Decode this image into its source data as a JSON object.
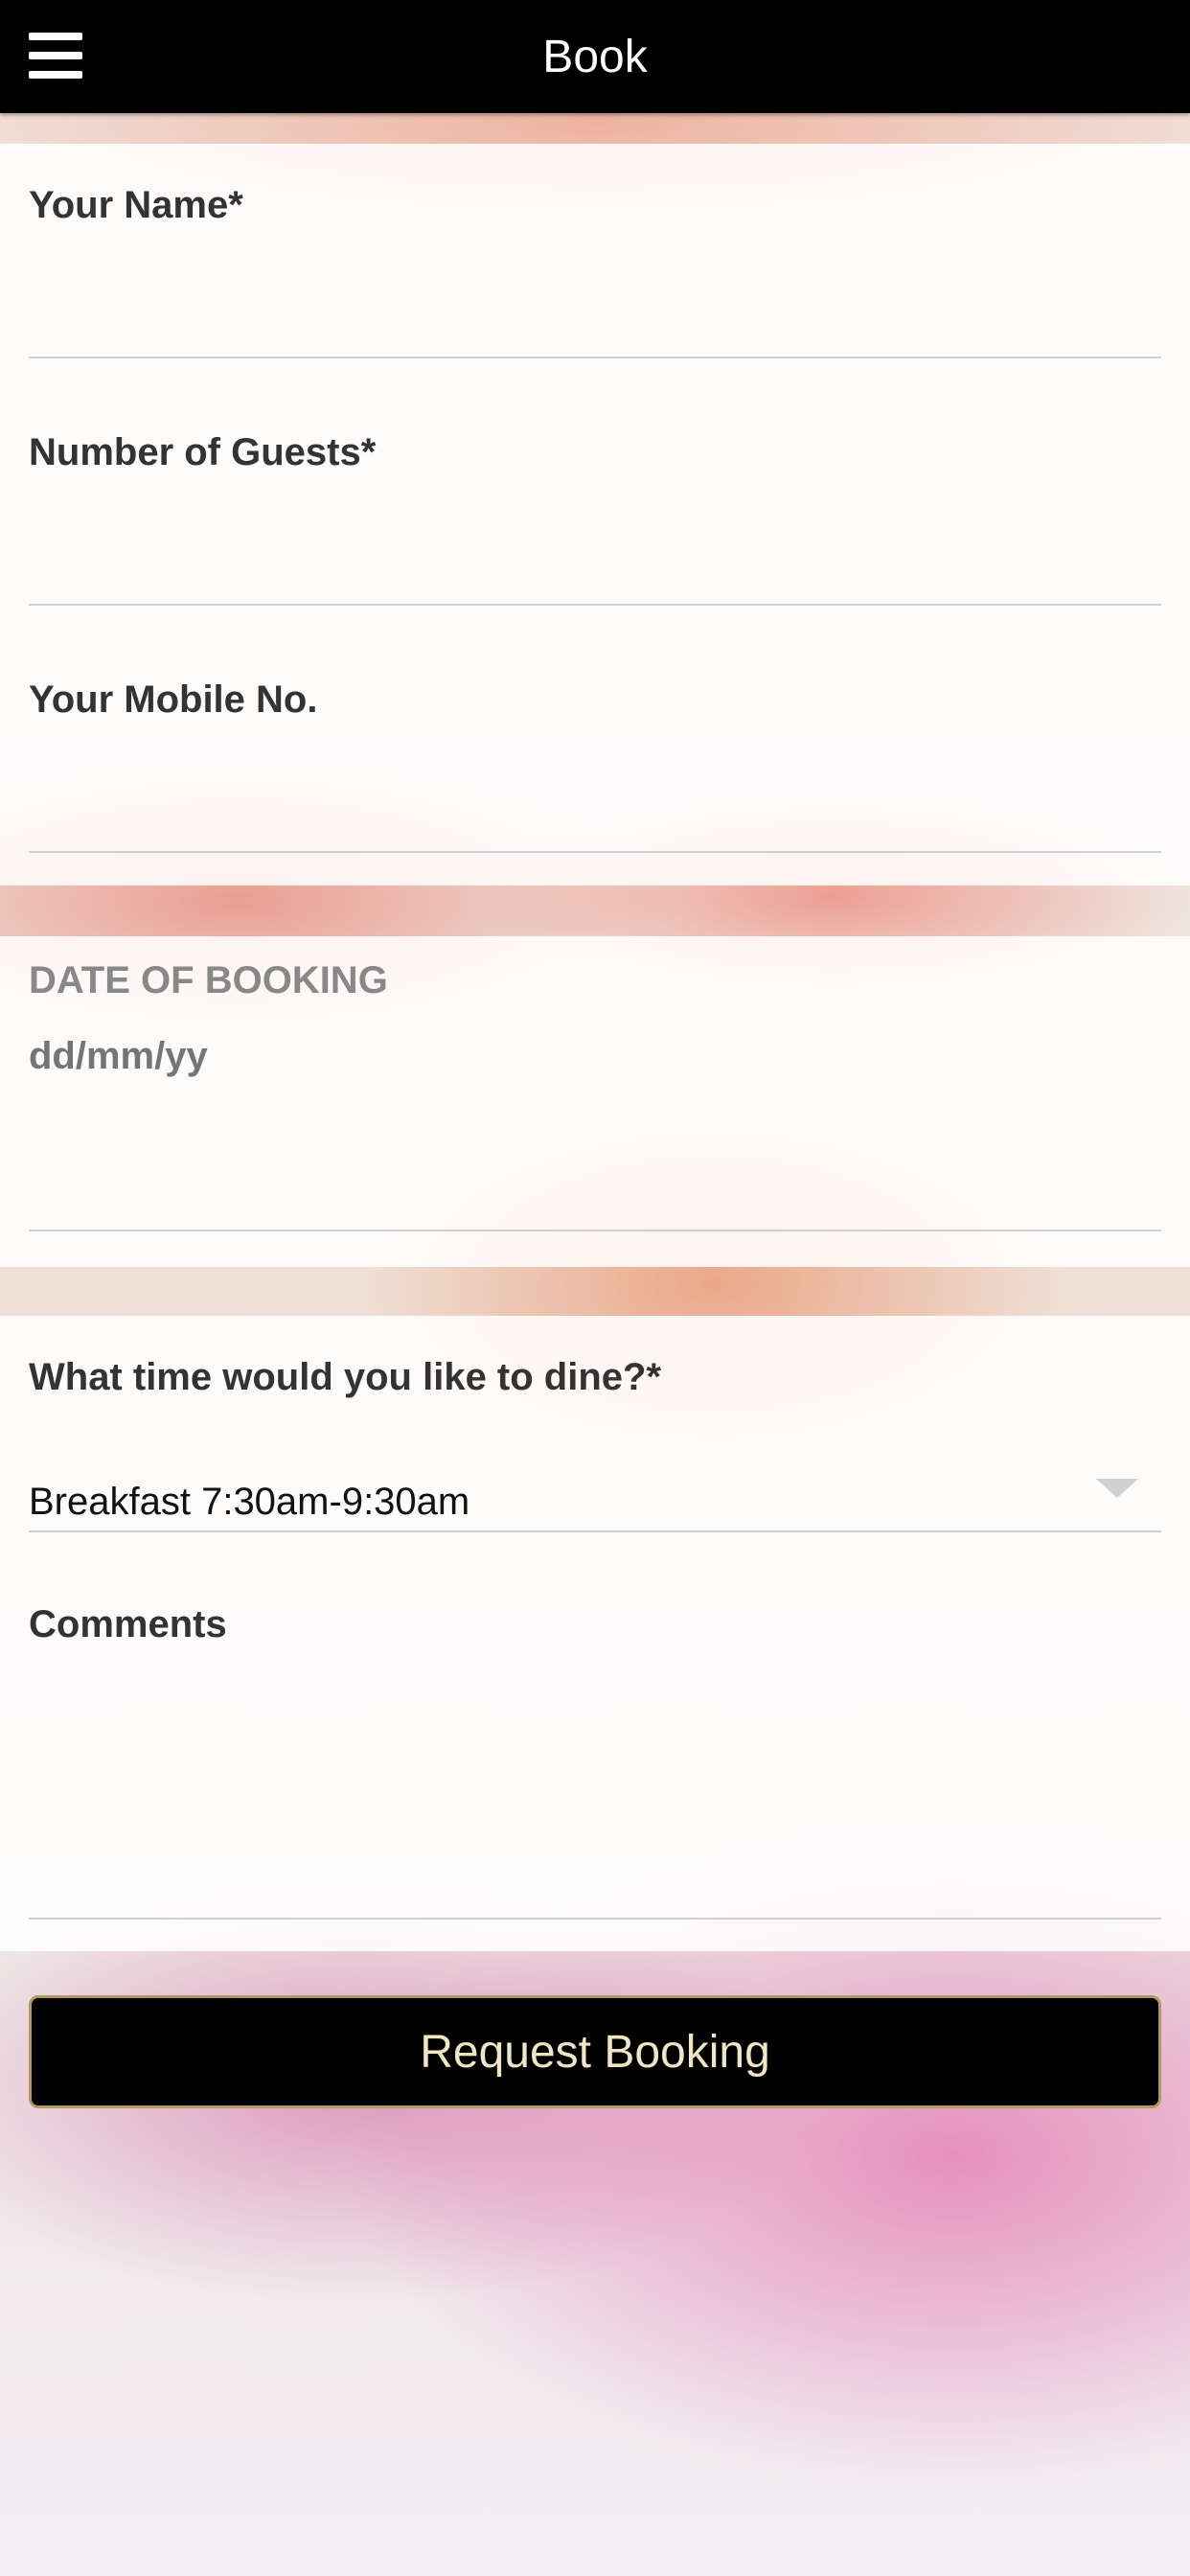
{
  "header": {
    "title": "Book",
    "menu_icon": "hamburger-menu-icon"
  },
  "form": {
    "name": {
      "label": "Your Name*",
      "value": ""
    },
    "guests": {
      "label": "Number of Guests*",
      "value": ""
    },
    "mobile": {
      "label": "Your Mobile No.",
      "value": ""
    },
    "date_section": {
      "heading": "DATE OF BOOKING",
      "placeholder": "dd/mm/yy",
      "value": ""
    },
    "time": {
      "label": "What time would you like to dine?*",
      "selected": "Breakfast 7:30am-9:30am",
      "icon": "chevron-down-icon"
    },
    "comments": {
      "label": "Comments",
      "value": ""
    },
    "submit_label": "Request Booking"
  },
  "colors": {
    "header_bg": "#000000",
    "button_bg": "#000000",
    "button_border": "#b09a5e",
    "button_text": "#f1e6c4",
    "label_text": "#333333",
    "section_header_text": "#888888"
  }
}
